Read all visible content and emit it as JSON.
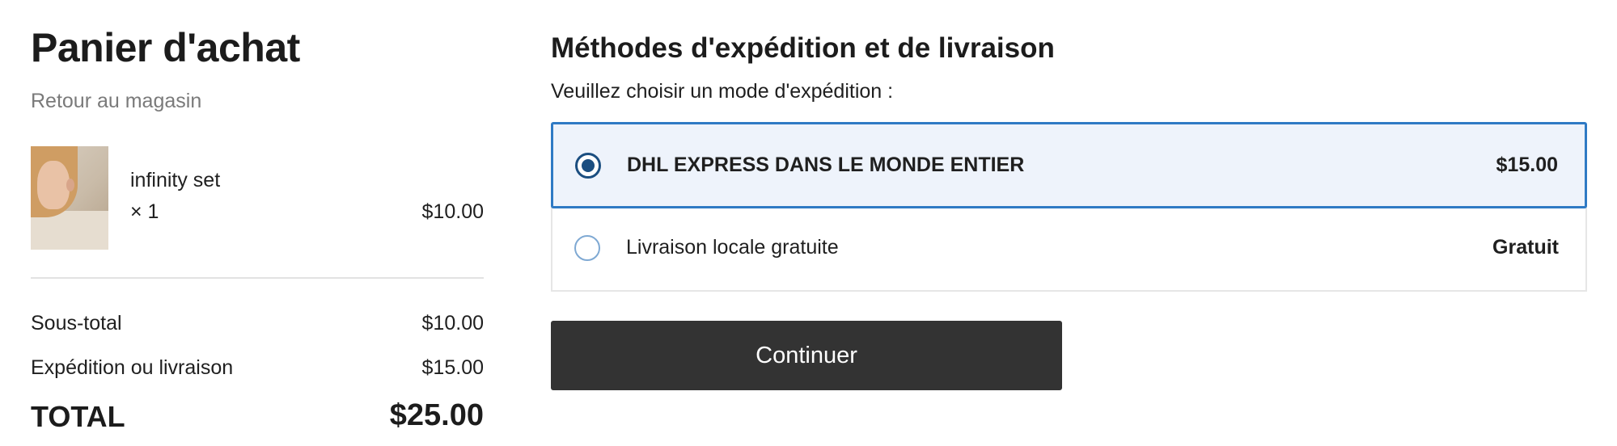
{
  "cart": {
    "title": "Panier d'achat",
    "back_link": "Retour au magasin",
    "item": {
      "image_icon": "product-photo",
      "name": "infinity set",
      "quantity": "× 1",
      "price": "$10.00"
    },
    "summary": {
      "subtotal_label": "Sous-total",
      "subtotal_value": "$10.00",
      "shipping_label": "Expédition ou livraison",
      "shipping_value": "$15.00",
      "total_label": "TOTAL",
      "total_value": "$25.00"
    }
  },
  "shipping": {
    "title": "Méthodes d'expédition et de livraison",
    "instruction": "Veuillez choisir un mode d'expédition :",
    "options": [
      {
        "label": "DHL EXPRESS DANS LE MONDE ENTIER",
        "price": "$15.00",
        "selected": true
      },
      {
        "label": "Livraison locale gratuite",
        "price": "Gratuit",
        "selected": false
      }
    ],
    "continue_label": "Continuer"
  },
  "colors": {
    "accent": "#2f7ac4",
    "radio_selected": "#1b4e80",
    "selected_bg": "#eef3fb",
    "button_bg": "#333333"
  }
}
